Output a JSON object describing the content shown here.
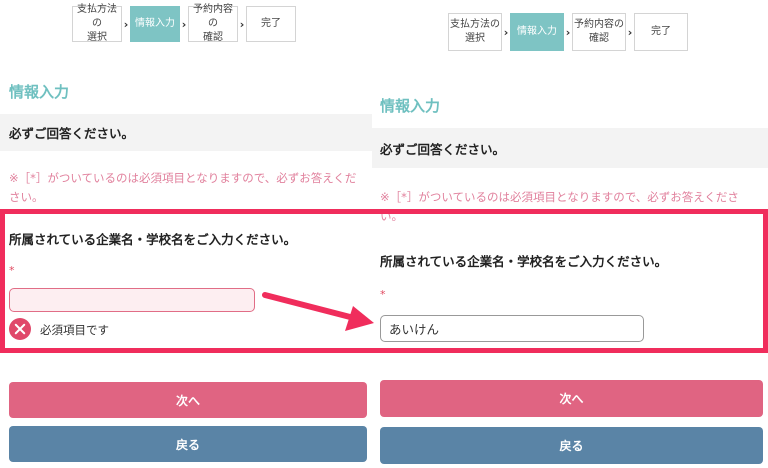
{
  "steps": [
    {
      "line1": "支払方法の",
      "line2": "選択"
    },
    {
      "line1": "情報入力",
      "line2": ""
    },
    {
      "line1": "予約内容の",
      "line2": "確認"
    },
    {
      "line1": "完了",
      "line2": ""
    }
  ],
  "step_chevron": "›",
  "section_title": "情報入力",
  "band_text": "必ずご回答ください。",
  "notice_text": "※［*］がついているのは必須項目となりますので、必ずお答えください。",
  "question_label": "所属されている企業名・学校名をご入力ください。",
  "required_mark": "*",
  "left_input": {
    "value": ""
  },
  "right_input": {
    "value": "あいけん"
  },
  "error_text": "必須項目です",
  "buttons": {
    "next_label": "次へ",
    "back_label": "戻る"
  },
  "colors": {
    "accent_teal": "#7ec4c4",
    "notice_pink": "#e1819d",
    "next_button": "#e06482",
    "back_button": "#5a84a6",
    "highlight_border": "#f02d5c",
    "error_icon": "#e0486a"
  },
  "icons": {
    "error": "close-circle-icon",
    "arrow": "arrow-right-icon"
  }
}
